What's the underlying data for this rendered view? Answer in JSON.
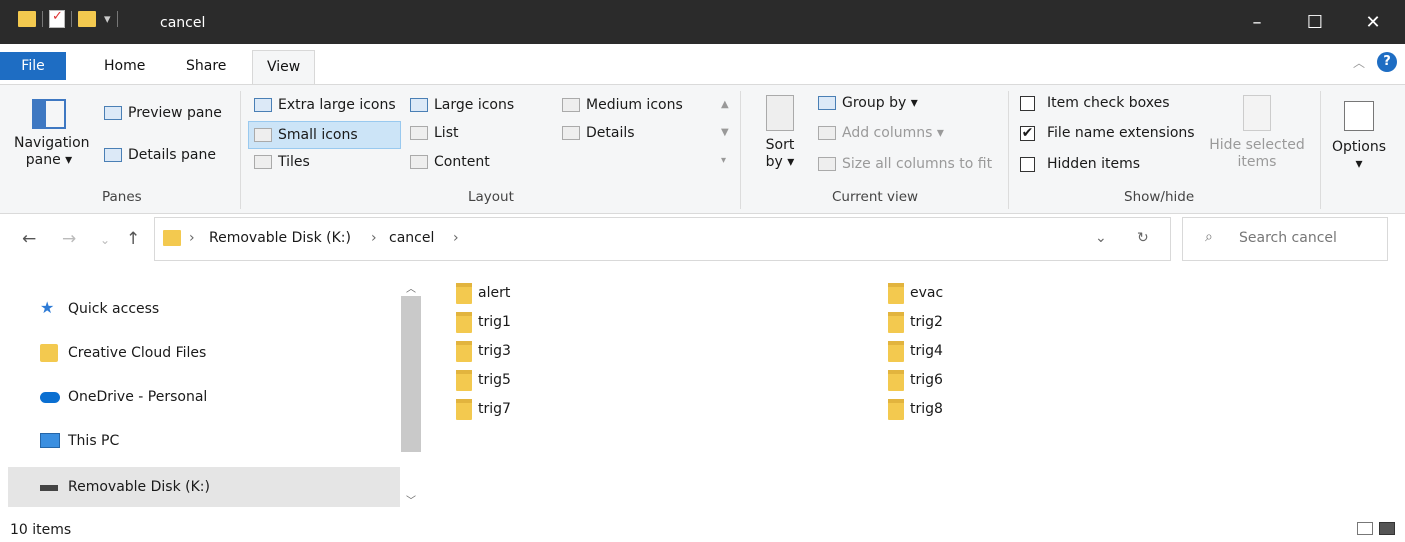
{
  "window": {
    "title": "cancel"
  },
  "tabs": {
    "file": "File",
    "home": "Home",
    "share": "Share",
    "view": "View"
  },
  "ribbon": {
    "panes": {
      "label": "Panes",
      "navigation_pane_line1": "Navigation",
      "navigation_pane_line2": "pane ▾",
      "preview_pane": "Preview pane",
      "details_pane": "Details pane"
    },
    "layout": {
      "label": "Layout",
      "extra_large_icons": "Extra large icons",
      "large_icons": "Large icons",
      "medium_icons": "Medium icons",
      "small_icons": "Small icons",
      "list": "List",
      "details": "Details",
      "tiles": "Tiles",
      "content": "Content"
    },
    "current_view": {
      "label": "Current view",
      "sort_by_line1": "Sort",
      "sort_by_line2": "by ▾",
      "group_by": "Group by ▾",
      "add_columns": "Add columns ▾",
      "size_all_columns": "Size all columns to fit"
    },
    "show_hide": {
      "label": "Show/hide",
      "item_check_boxes": "Item check boxes",
      "item_check_boxes_checked": false,
      "file_name_extensions": "File name extensions",
      "file_name_extensions_checked": true,
      "hidden_items": "Hidden items",
      "hidden_items_checked": false,
      "hide_selected_line1": "Hide selected",
      "hide_selected_line2": "items",
      "options_line1": "Options",
      "options_line2": "▾"
    }
  },
  "address": {
    "crumbs": [
      "Removable Disk (K:)",
      "cancel"
    ],
    "search_placeholder": "Search cancel"
  },
  "nav_pane": {
    "items": [
      {
        "label": "Quick access",
        "icon": "star-icon"
      },
      {
        "label": "Creative Cloud Files",
        "icon": "creative-cloud-icon"
      },
      {
        "label": "OneDrive - Personal",
        "icon": "cloud-icon"
      },
      {
        "label": "This PC",
        "icon": "monitor-icon"
      },
      {
        "label": "Removable Disk (K:)",
        "icon": "drive-icon"
      }
    ]
  },
  "files": [
    "alert",
    "evac",
    "trig1",
    "trig2",
    "trig3",
    "trig4",
    "trig5",
    "trig6",
    "trig7",
    "trig8"
  ],
  "status": {
    "item_count": "10 items"
  },
  "colors": {
    "accent": "#1e6dc3",
    "folder": "#f3c94f",
    "titlebar": "#2b2b2b"
  }
}
